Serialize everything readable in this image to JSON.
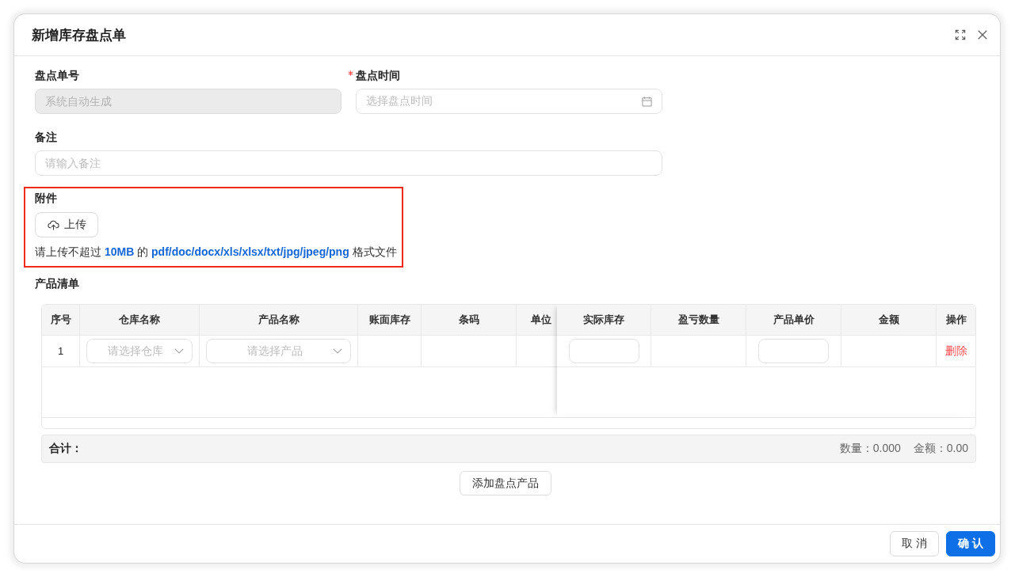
{
  "dialog": {
    "title": "新增库存盘点单"
  },
  "form": {
    "rows": [
      {
        "fields": [
          {
            "kind": "text",
            "label": "盘点单号",
            "required": false,
            "disabled": true,
            "placeholder": "系统自动生成"
          },
          {
            "kind": "date",
            "label": "盘点时间",
            "required": true,
            "disabled": false,
            "placeholder": "选择盘点时间"
          }
        ]
      },
      {
        "fields": [
          {
            "kind": "text",
            "label": "备注",
            "required": false,
            "disabled": false,
            "placeholder": "请输入备注"
          }
        ]
      }
    ]
  },
  "attachment": {
    "label": "附件",
    "highlighted": true,
    "upload_button": "上传",
    "hint": "请上传不超过 **10MB** 的 **pdf/doc/docx/xls/xlsx/txt/jpg/jpeg/png** 格式文件"
  },
  "products": {
    "title": "产品清单",
    "columns": [
      {
        "label": "序号"
      },
      {
        "label": "仓库名称"
      },
      {
        "label": "产品名称"
      },
      {
        "label": "账面库存"
      },
      {
        "label": "条码"
      },
      {
        "label": "单位"
      }
    ],
    "fixed_columns": [
      {
        "label": "实际库存"
      },
      {
        "label": "盈亏数量"
      },
      {
        "label": "产品单价"
      },
      {
        "label": "金额"
      },
      {
        "label": "操作"
      }
    ],
    "rows": [
      {
        "cells": [
          {
            "kind": "text",
            "text": "1"
          },
          {
            "kind": "select",
            "placeholder": "请选择仓库"
          },
          {
            "kind": "select",
            "placeholder": "请选择产品"
          },
          {
            "kind": "blank"
          },
          {
            "kind": "blank"
          },
          {
            "kind": "blank"
          }
        ],
        "fixed_cells": [
          {
            "kind": "input"
          },
          {
            "kind": "blank"
          },
          {
            "kind": "input"
          },
          {
            "kind": "blank"
          },
          {
            "kind": "danger-link",
            "text": "删除"
          }
        ]
      }
    ],
    "summary": {
      "label": "合计：",
      "quantity": "数量：0.000",
      "amount": "金额：0.00"
    },
    "add_button": "添加盘点产品"
  },
  "footer": {
    "buttons": [
      {
        "kind": "default",
        "label": "取 消"
      },
      {
        "kind": "primary",
        "label": "确 认"
      }
    ]
  }
}
